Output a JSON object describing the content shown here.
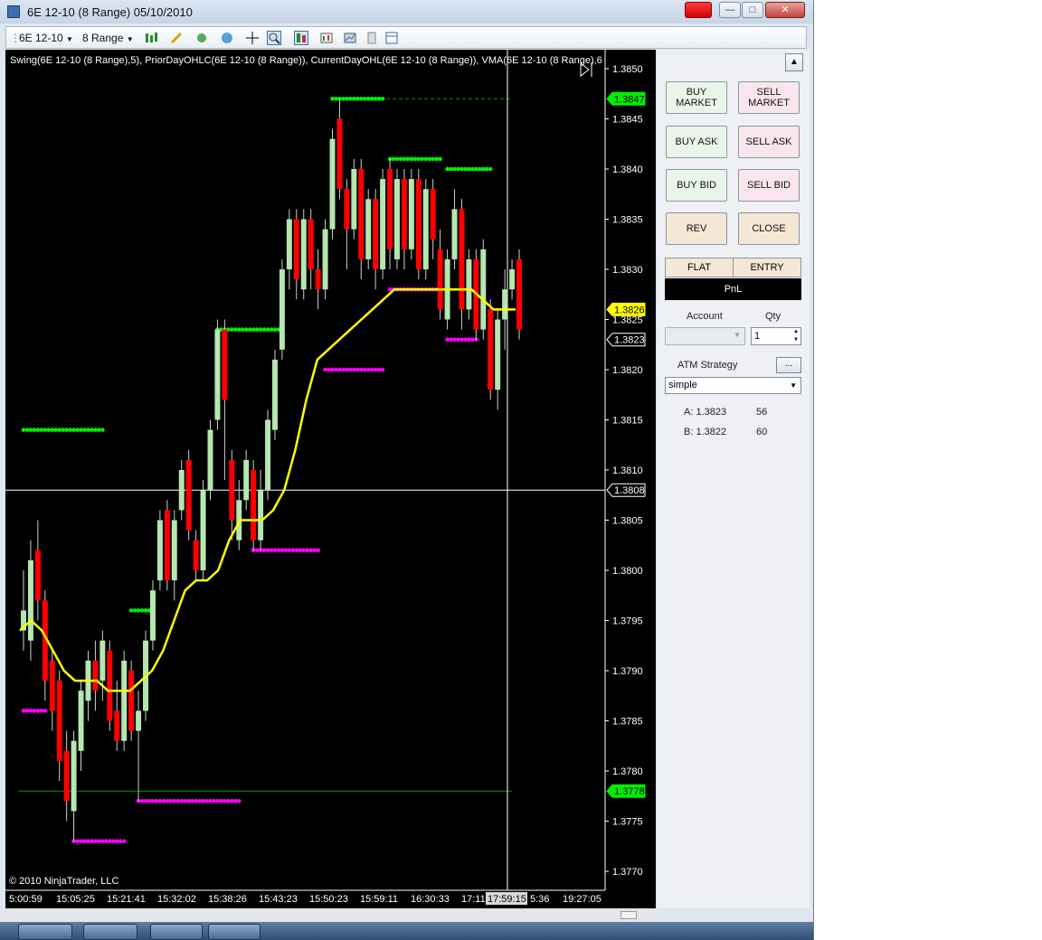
{
  "window": {
    "title": "6E 12-10 (8 Range)  05/10/2010"
  },
  "toolbar": {
    "instrument": "6E 12-10",
    "interval": "8 Range"
  },
  "chart": {
    "indicators_label": "Swing(6E 12-10 (8 Range),5), PriorDayOHLC(6E 12-10 (8 Range)), CurrentDayOHL(6E 12-10 (8 Range)), VMA(6E 12-10 (8 Range),6",
    "copyright": "© 2010 NinjaTrader, LLC",
    "price_ticks": [
      "1.3850",
      "1.3845",
      "1.3840",
      "1.3835",
      "1.3830",
      "1.3825",
      "1.3820",
      "1.3815",
      "1.3810",
      "1.3805",
      "1.3800",
      "1.3795",
      "1.3790",
      "1.3785",
      "1.3780",
      "1.3775",
      "1.3770"
    ],
    "price_markers": [
      {
        "label": "1.3847",
        "price": 1.3847,
        "color": "#00ee00"
      },
      {
        "label": "1.3826",
        "price": 1.3826,
        "color": "#ffff00"
      },
      {
        "label": "1.3823",
        "price": 1.3823,
        "color": "#000000"
      },
      {
        "label": "1.3808",
        "price": 1.3808,
        "color": "#000000"
      },
      {
        "label": "1.3778",
        "price": 1.3778,
        "color": "#00ee00"
      }
    ],
    "time_labels": [
      "5:00:59",
      "15:05:25",
      "15:21:41",
      "15:32:02",
      "15:38:26",
      "15:43:23",
      "15:50:23",
      "15:59:11",
      "16:30:33",
      "17:11:",
      "5:36",
      "19:27:05"
    ],
    "cursor_time": "17:59:15"
  },
  "chart_data": {
    "type": "candlestick",
    "y_axis_range": [
      1.3768,
      1.3852
    ],
    "candles": [
      {
        "o": 1.3794,
        "c": 1.3796,
        "h": 1.38,
        "l": 1.3792
      },
      {
        "o": 1.3793,
        "c": 1.3801,
        "h": 1.3803,
        "l": 1.3791
      },
      {
        "o": 1.3802,
        "c": 1.3797,
        "h": 1.3805,
        "l": 1.3795
      },
      {
        "o": 1.3797,
        "c": 1.3789,
        "h": 1.3798,
        "l": 1.3787
      },
      {
        "o": 1.3791,
        "c": 1.3786,
        "h": 1.3792,
        "l": 1.3784
      },
      {
        "o": 1.3789,
        "c": 1.3781,
        "h": 1.379,
        "l": 1.3779
      },
      {
        "o": 1.3782,
        "c": 1.3777,
        "h": 1.3784,
        "l": 1.3775
      },
      {
        "o": 1.3776,
        "c": 1.3783,
        "h": 1.3784,
        "l": 1.3773
      },
      {
        "o": 1.3782,
        "c": 1.3788,
        "h": 1.3789,
        "l": 1.378
      },
      {
        "o": 1.3787,
        "c": 1.3791,
        "h": 1.3792,
        "l": 1.3785
      },
      {
        "o": 1.3791,
        "c": 1.3788,
        "h": 1.3793,
        "l": 1.3786
      },
      {
        "o": 1.3789,
        "c": 1.3793,
        "h": 1.3794,
        "l": 1.3787
      },
      {
        "o": 1.3792,
        "c": 1.3785,
        "h": 1.3793,
        "l": 1.3784
      },
      {
        "o": 1.3786,
        "c": 1.3783,
        "h": 1.3789,
        "l": 1.3782
      },
      {
        "o": 1.3783,
        "c": 1.3791,
        "h": 1.3792,
        "l": 1.3782
      },
      {
        "o": 1.379,
        "c": 1.3784,
        "h": 1.3791,
        "l": 1.3783
      },
      {
        "o": 1.3784,
        "c": 1.3786,
        "h": 1.3788,
        "l": 1.3777
      },
      {
        "o": 1.3786,
        "c": 1.3793,
        "h": 1.3794,
        "l": 1.3785
      },
      {
        "o": 1.3793,
        "c": 1.3798,
        "h": 1.3799,
        "l": 1.3792
      },
      {
        "o": 1.3799,
        "c": 1.3805,
        "h": 1.3806,
        "l": 1.3798
      },
      {
        "o": 1.3806,
        "c": 1.3799,
        "h": 1.3807,
        "l": 1.3798
      },
      {
        "o": 1.3799,
        "c": 1.3805,
        "h": 1.3806,
        "l": 1.3797
      },
      {
        "o": 1.3806,
        "c": 1.381,
        "h": 1.3811,
        "l": 1.3805
      },
      {
        "o": 1.3811,
        "c": 1.3804,
        "h": 1.3812,
        "l": 1.3803
      },
      {
        "o": 1.3803,
        "c": 1.38,
        "h": 1.3804,
        "l": 1.3799
      },
      {
        "o": 1.38,
        "c": 1.3808,
        "h": 1.3809,
        "l": 1.3799
      },
      {
        "o": 1.3808,
        "c": 1.3814,
        "h": 1.3815,
        "l": 1.3807
      },
      {
        "o": 1.3815,
        "c": 1.3824,
        "h": 1.3825,
        "l": 1.3814
      },
      {
        "o": 1.3824,
        "c": 1.3817,
        "h": 1.3825,
        "l": 1.3809
      },
      {
        "o": 1.3811,
        "c": 1.3805,
        "h": 1.3812,
        "l": 1.3803
      },
      {
        "o": 1.3803,
        "c": 1.3807,
        "h": 1.3809,
        "l": 1.3802
      },
      {
        "o": 1.3807,
        "c": 1.3811,
        "h": 1.3812,
        "l": 1.3806
      },
      {
        "o": 1.381,
        "c": 1.3803,
        "h": 1.3811,
        "l": 1.3802
      },
      {
        "o": 1.3803,
        "c": 1.3808,
        "h": 1.381,
        "l": 1.3802
      },
      {
        "o": 1.3808,
        "c": 1.3815,
        "h": 1.3816,
        "l": 1.3807
      },
      {
        "o": 1.3814,
        "c": 1.3821,
        "h": 1.3822,
        "l": 1.3813
      },
      {
        "o": 1.3822,
        "c": 1.383,
        "h": 1.3831,
        "l": 1.3821
      },
      {
        "o": 1.383,
        "c": 1.3835,
        "h": 1.3836,
        "l": 1.3828
      },
      {
        "o": 1.3835,
        "c": 1.3829,
        "h": 1.3836,
        "l": 1.3827
      },
      {
        "o": 1.3828,
        "c": 1.3835,
        "h": 1.3836,
        "l": 1.3827
      },
      {
        "o": 1.3835,
        "c": 1.383,
        "h": 1.3836,
        "l": 1.3828
      },
      {
        "o": 1.383,
        "c": 1.3828,
        "h": 1.3832,
        "l": 1.3826
      },
      {
        "o": 1.3828,
        "c": 1.3834,
        "h": 1.3835,
        "l": 1.3827
      },
      {
        "o": 1.3834,
        "c": 1.3843,
        "h": 1.3844,
        "l": 1.3833
      },
      {
        "o": 1.3845,
        "c": 1.3838,
        "h": 1.3847,
        "l": 1.3837
      },
      {
        "o": 1.3838,
        "c": 1.3834,
        "h": 1.3839,
        "l": 1.383
      },
      {
        "o": 1.3834,
        "c": 1.384,
        "h": 1.3841,
        "l": 1.3833
      },
      {
        "o": 1.384,
        "c": 1.3831,
        "h": 1.3841,
        "l": 1.3829
      },
      {
        "o": 1.3831,
        "c": 1.3837,
        "h": 1.3838,
        "l": 1.383
      },
      {
        "o": 1.3837,
        "c": 1.383,
        "h": 1.3838,
        "l": 1.3828
      },
      {
        "o": 1.383,
        "c": 1.3839,
        "h": 1.384,
        "l": 1.3829
      },
      {
        "o": 1.384,
        "c": 1.3832,
        "h": 1.3841,
        "l": 1.383
      },
      {
        "o": 1.3831,
        "c": 1.3839,
        "h": 1.384,
        "l": 1.383
      },
      {
        "o": 1.3839,
        "c": 1.3832,
        "h": 1.384,
        "l": 1.383
      },
      {
        "o": 1.3832,
        "c": 1.3839,
        "h": 1.384,
        "l": 1.3831
      },
      {
        "o": 1.3839,
        "c": 1.383,
        "h": 1.384,
        "l": 1.3829
      },
      {
        "o": 1.383,
        "c": 1.3838,
        "h": 1.3839,
        "l": 1.3829
      },
      {
        "o": 1.3838,
        "c": 1.3833,
        "h": 1.3839,
        "l": 1.3831
      },
      {
        "o": 1.3832,
        "c": 1.3826,
        "h": 1.3834,
        "l": 1.3825
      },
      {
        "o": 1.3825,
        "c": 1.3831,
        "h": 1.3832,
        "l": 1.3824
      },
      {
        "o": 1.3831,
        "c": 1.3836,
        "h": 1.3838,
        "l": 1.383
      },
      {
        "o": 1.3836,
        "c": 1.3826,
        "h": 1.3837,
        "l": 1.3824
      },
      {
        "o": 1.3826,
        "c": 1.3831,
        "h": 1.3832,
        "l": 1.3825
      },
      {
        "o": 1.3831,
        "c": 1.3824,
        "h": 1.3832,
        "l": 1.3823
      },
      {
        "o": 1.3824,
        "c": 1.3832,
        "h": 1.3833,
        "l": 1.3823
      },
      {
        "o": 1.3826,
        "c": 1.3818,
        "h": 1.3827,
        "l": 1.3817
      },
      {
        "o": 1.3818,
        "c": 1.3825,
        "h": 1.3826,
        "l": 1.3816
      },
      {
        "o": 1.3825,
        "c": 1.3828,
        "h": 1.383,
        "l": 1.3822
      },
      {
        "o": 1.3828,
        "c": 1.383,
        "h": 1.3831,
        "l": 1.3827
      },
      {
        "o": 1.3831,
        "c": 1.3824,
        "h": 1.3832,
        "l": 1.3823
      }
    ],
    "vma_line": [
      1.3794,
      1.3795,
      1.3794,
      1.3792,
      1.379,
      1.3789,
      1.3789,
      1.3789,
      1.3788,
      1.3788,
      1.3788,
      1.3789,
      1.379,
      1.3792,
      1.3795,
      1.3798,
      1.3799,
      1.3799,
      1.38,
      1.3803,
      1.3805,
      1.3805,
      1.3805,
      1.3806,
      1.3808,
      1.3812,
      1.3817,
      1.3821,
      1.3822,
      1.3823,
      1.3824,
      1.3825,
      1.3826,
      1.3827,
      1.3828,
      1.3828,
      1.3828,
      1.3828,
      1.3828,
      1.3828,
      1.3828,
      1.3828,
      1.3827,
      1.3826,
      1.3826,
      1.3826
    ],
    "swing_highs": [
      {
        "price": 1.3814,
        "from": 0,
        "to": 11
      },
      {
        "price": 1.3796,
        "from": 15,
        "to": 18
      },
      {
        "price": 1.3824,
        "from": 27,
        "to": 36
      },
      {
        "price": 1.3847,
        "from": 43,
        "to": 50
      },
      {
        "price": 1.3841,
        "from": 51,
        "to": 58
      },
      {
        "price": 1.384,
        "from": 59,
        "to": 65
      }
    ],
    "swing_lows": [
      {
        "price": 1.3786,
        "from": 0,
        "to": 3
      },
      {
        "price": 1.3773,
        "from": 7,
        "to": 14
      },
      {
        "price": 1.3777,
        "from": 16,
        "to": 30
      },
      {
        "price": 1.3802,
        "from": 32,
        "to": 41
      },
      {
        "price": 1.382,
        "from": 42,
        "to": 50
      },
      {
        "price": 1.3828,
        "from": 51,
        "to": 58
      },
      {
        "price": 1.3823,
        "from": 59,
        "to": 63
      }
    ],
    "lines": [
      {
        "kind": "current-day-high",
        "price": 1.3847
      },
      {
        "kind": "prior-day-low",
        "price": 1.3778
      },
      {
        "kind": "crosshair",
        "price": 1.3808
      }
    ]
  },
  "order_panel": {
    "buy_market": "BUY\nMARKET",
    "sell_market": "SELL\nMARKET",
    "buy_ask": "BUY ASK",
    "sell_ask": "SELL ASK",
    "buy_bid": "BUY BID",
    "sell_bid": "SELL BID",
    "rev": "REV",
    "close": "CLOSE",
    "flat": "FLAT",
    "entry": "ENTRY",
    "pnl": "PnL",
    "account_label": "Account",
    "qty_label": "Qty",
    "qty_value": "1",
    "atm_label": "ATM Strategy",
    "atm_more": "...",
    "atm_value": "simple",
    "a_label": "A: 1.3823",
    "a_value": "56",
    "b_label": "B: 1.3822",
    "b_value": "60"
  },
  "colors": {
    "up": "#b6e7b0",
    "down": "#ff0000",
    "swing_high": "#00ee00",
    "swing_low": "#ff00ff",
    "vma": "#ffff00"
  }
}
